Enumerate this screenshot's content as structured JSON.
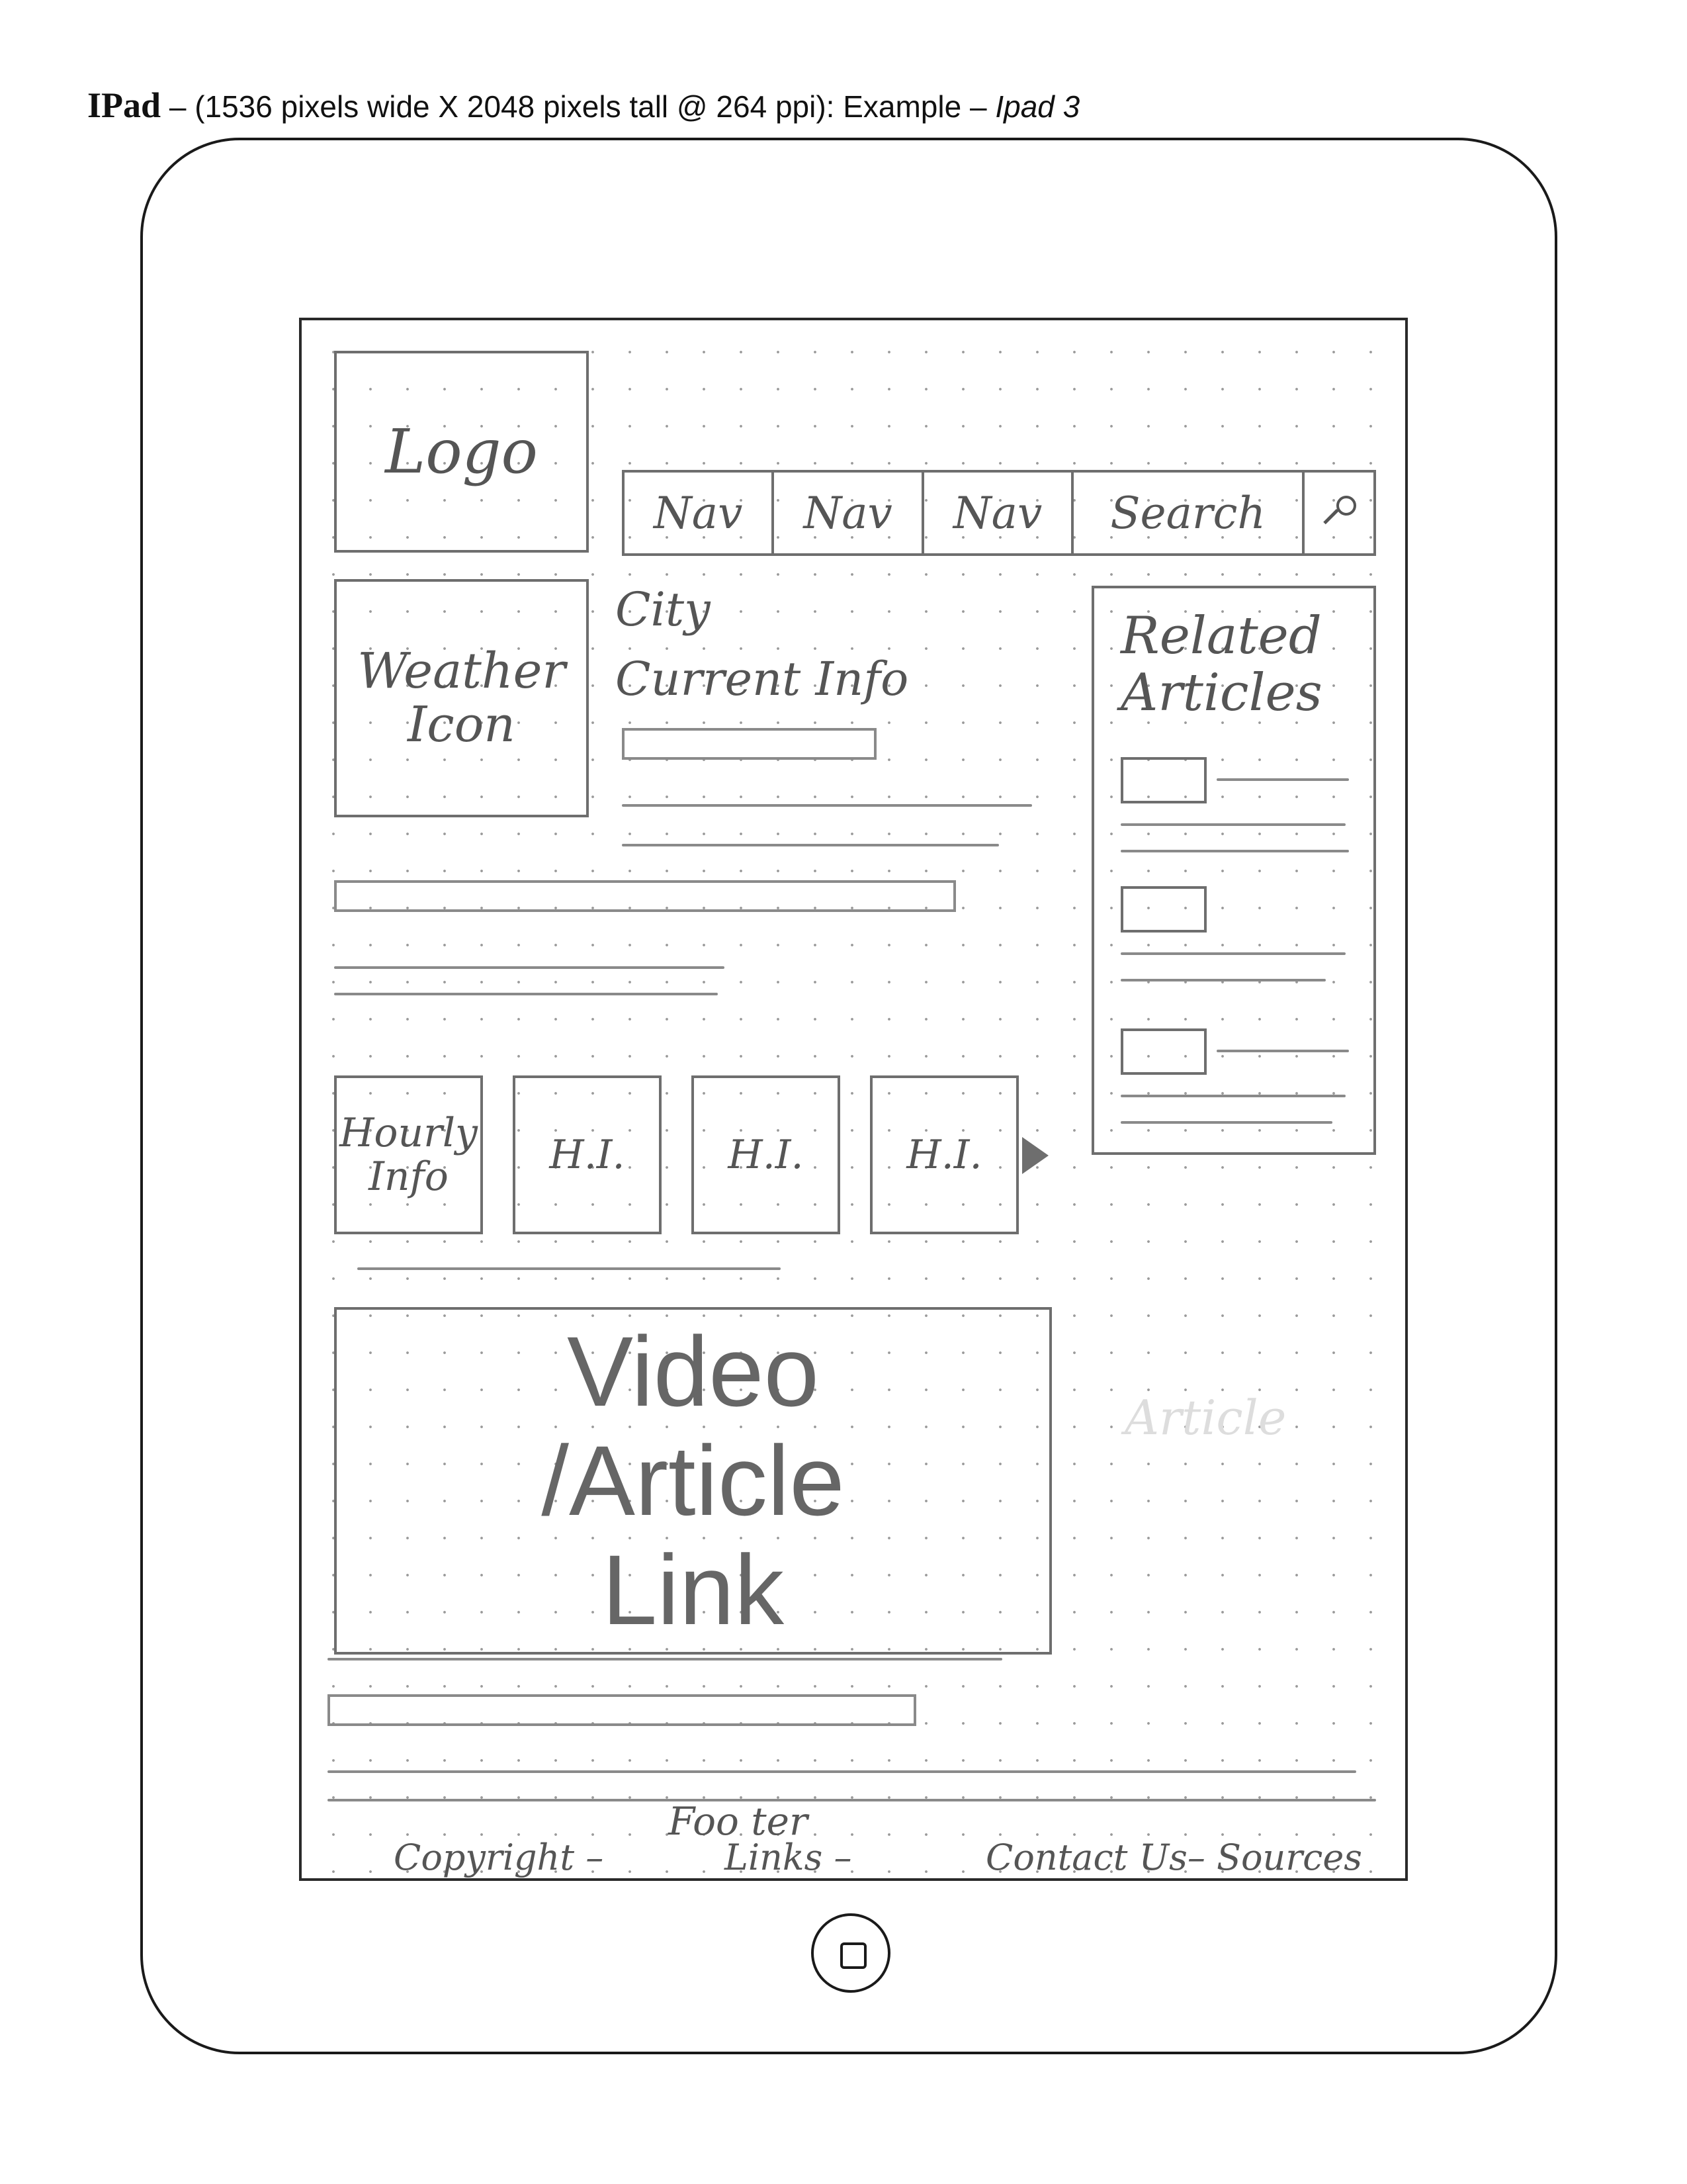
{
  "page": {
    "device": "IPad",
    "spec": " – (1536 pixels wide X 2048 pixels tall @ 264 ppi): Example – ",
    "example_model": "Ipad 3"
  },
  "header": {
    "logo": "Logo",
    "nav": [
      "Nav",
      "Nav",
      "Nav"
    ],
    "search": "Search"
  },
  "weather": {
    "icon_label": "Weather Icon",
    "city": "City",
    "current_info": "Current Info"
  },
  "related": {
    "title": "Related Articles"
  },
  "hourly": {
    "first_label": "Hourly Info",
    "items": [
      "H.I.",
      "H.I.",
      "H.I."
    ]
  },
  "feature": {
    "video_link": "Video /Article Link",
    "faint_label": "Article"
  },
  "footer": {
    "label": "Foo ter",
    "items": [
      "Copyright –",
      "Links –",
      "Contact Us– Sources"
    ]
  },
  "icons": {
    "search": "magnifier-icon",
    "next": "arrow-right-icon",
    "home": "home-button-icon"
  }
}
